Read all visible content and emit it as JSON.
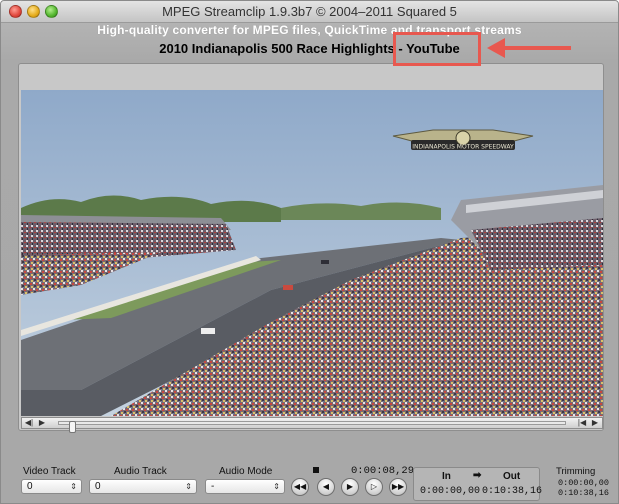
{
  "window": {
    "title": "MPEG Streamclip 1.9.3b7  ©  2004–2011 Squared 5",
    "subtitle": "High-quality converter for MPEG files, QuickTime and transport streams",
    "file_title": "2010 Indianapolis 500 Race Highlights - YouTube"
  },
  "video": {
    "banner_text": "INDIANAPOLIS MOTOR SPEEDWAY"
  },
  "scrubber": {
    "left_icons": [
      "◀|",
      "▶"
    ],
    "right_icons": [
      "|◀",
      "▶"
    ],
    "position_fraction": 0.02
  },
  "controls": {
    "video_track": {
      "label": "Video Track",
      "value": "0"
    },
    "audio_track": {
      "label": "Audio Track",
      "value": "0"
    },
    "audio_mode": {
      "label": "Audio Mode",
      "value": "-"
    },
    "current_time": "0:00:08,29",
    "transport": {
      "rewind": "◀◀",
      "step_back": "◀",
      "play": "▶",
      "step_forward": "▷",
      "fast_forward": "▶▶"
    },
    "in_label": "In",
    "out_label": "Out",
    "in_time": "0:00:00,00",
    "out_time": "0:10:38,16",
    "trimming_label": "Trimming",
    "trimming_in": "0:00:00,00",
    "trimming_out": "0:10:38,16"
  },
  "annotation": {
    "highlight_color": "#e8584f"
  }
}
